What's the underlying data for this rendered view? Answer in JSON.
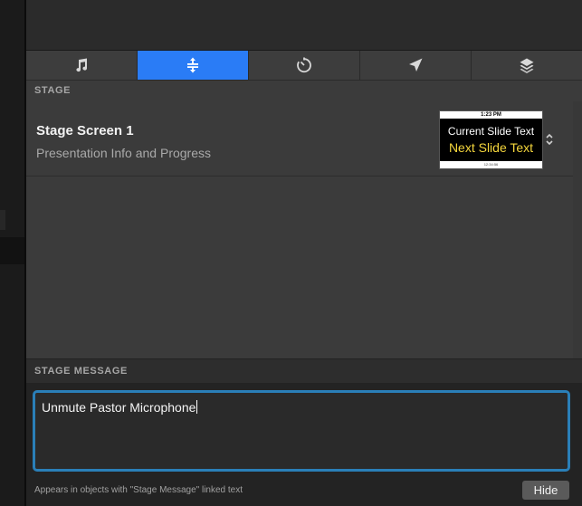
{
  "tabs": [
    {
      "id": "audio",
      "icon": "music-note-icon",
      "active": false
    },
    {
      "id": "stage",
      "icon": "stage-split-icon",
      "active": true
    },
    {
      "id": "timers",
      "icon": "timer-icon",
      "active": false
    },
    {
      "id": "messages",
      "icon": "send-arrow-icon",
      "active": false
    },
    {
      "id": "props",
      "icon": "layers-icon",
      "active": false
    }
  ],
  "stage": {
    "section_label": "STAGE",
    "screens": [
      {
        "name": "Stage Screen 1",
        "layout": "Presentation Info and Progress",
        "thumbnail": {
          "clock": "1:23 PM",
          "current_label": "Current Slide Text",
          "next_label": "Next Slide Text",
          "timer": "12:34:56"
        }
      }
    ]
  },
  "stage_message": {
    "section_label": "STAGE MESSAGE",
    "value": "Unmute Pastor Microphone",
    "hint": "Appears in objects with \"Stage Message\" linked text",
    "hide_label": "Hide"
  },
  "colors": {
    "accent": "#2a7cf6",
    "focus_ring": "#2a7fb8",
    "next_slide_text": "#f5d63c"
  }
}
